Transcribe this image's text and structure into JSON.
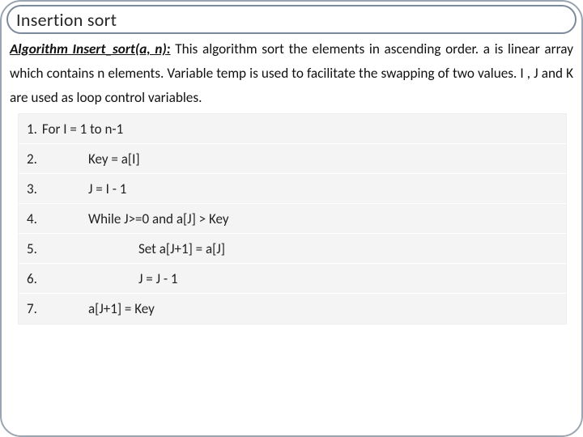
{
  "title": "Insertion sort",
  "description": {
    "alg_label": "Algorithm Insert_sort(a, n):",
    "rest": " This algorithm sort the elements in ascending order. a is linear array which contains n elements. Variable temp is used to facilitate the swapping of two values. I , J and K are used as loop control variables."
  },
  "code": {
    "rows": [
      {
        "n": "1.",
        "txt": "For I = 1 to n-1",
        "indent": "ind0",
        "first": true
      },
      {
        "n": "2.",
        "txt": "Key = a[I]",
        "indent": "ind1"
      },
      {
        "n": "3.",
        "txt": "J = I - 1",
        "indent": "ind1"
      },
      {
        "n": "4.",
        "txt": "While J>=0 and a[J] > Key",
        "indent": "ind1"
      },
      {
        "n": "5.",
        "txt": "Set a[J+1] = a[J]",
        "indent": "ind2"
      },
      {
        "n": "6.",
        "txt": "J = J - 1",
        "indent": "ind2"
      },
      {
        "n": "7.",
        "txt": "a[J+1] = Key",
        "indent": "ind1"
      }
    ]
  }
}
